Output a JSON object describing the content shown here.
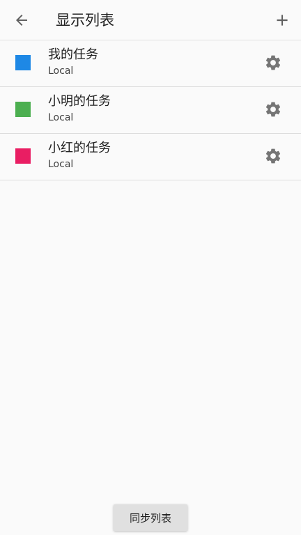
{
  "toolbar": {
    "title": "显示列表",
    "back_icon": "arrow-back-icon",
    "add_icon": "plus-icon"
  },
  "lists": [
    {
      "name": "我的任务",
      "account": "Local",
      "color": "#1e88e5"
    },
    {
      "name": "小明的任务",
      "account": "Local",
      "color": "#4caf50"
    },
    {
      "name": "小红的任务",
      "account": "Local",
      "color": "#e91e63"
    }
  ],
  "colors": {
    "icon": "#757575",
    "divider": "#dcdcdc",
    "button_bg": "#e0e0e0"
  },
  "sync_button": {
    "label": "同步列表"
  }
}
